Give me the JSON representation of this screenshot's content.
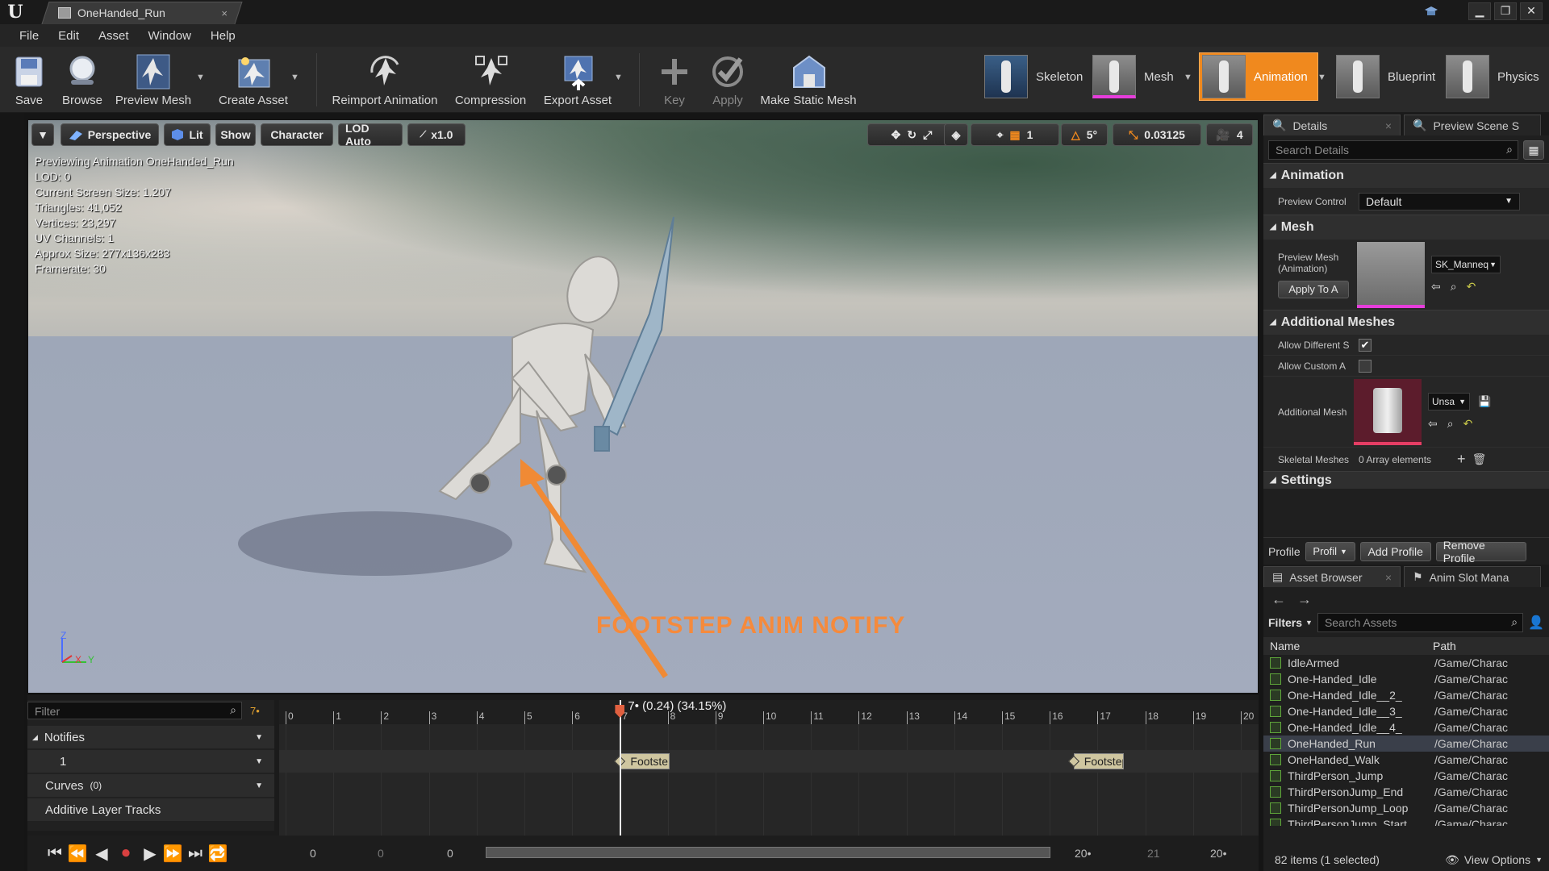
{
  "window": {
    "doc_tab": "OneHanded_Run",
    "tab_close": "×",
    "controls": [
      "▁",
      "❐",
      "✕"
    ]
  },
  "menu": [
    "File",
    "Edit",
    "Asset",
    "Window",
    "Help"
  ],
  "toolbar": {
    "buttons": [
      {
        "label": "Save",
        "icon": "save-icon"
      },
      {
        "label": "Browse",
        "icon": "browse-icon"
      },
      {
        "label": "Preview Mesh",
        "icon": "preview-mesh-icon"
      },
      {
        "label": "Create Asset",
        "icon": "create-asset-icon"
      },
      {
        "label": "Reimport Animation",
        "icon": "reimport-icon"
      },
      {
        "label": "Compression",
        "icon": "compression-icon"
      },
      {
        "label": "Export Asset",
        "icon": "export-icon"
      },
      {
        "label": "Key",
        "icon": "key-icon"
      },
      {
        "label": "Apply",
        "icon": "apply-icon"
      },
      {
        "label": "Make Static Mesh",
        "icon": "static-mesh-icon"
      }
    ],
    "modes": [
      "Skeleton",
      "Mesh",
      "Animation",
      "Blueprint",
      "Physics"
    ]
  },
  "viewport": {
    "buttons": {
      "perspective": "Perspective",
      "lit": "Lit",
      "show": "Show",
      "character": "Character",
      "lod": "LOD Auto",
      "speed": "x1.0"
    },
    "right_controls": {
      "grid_value": "1",
      "angle_value": "5°",
      "scale_value": "0.03125",
      "camera_speed": "4"
    },
    "info_lines": [
      "Previewing Animation OneHanded_Run",
      "LOD: 0",
      "Current Screen Size: 1.207",
      "Triangles: 41,052",
      "Vertices: 23,297",
      "UV Channels: 1",
      "Approx Size: 277x136x283",
      "Framerate: 30"
    ],
    "annotation": "FOOTSTEP ANIM NOTIFY",
    "axis": {
      "z": "Z",
      "x": "X",
      "y": "Y"
    }
  },
  "details": {
    "tabs": [
      "Details",
      "Preview Scene S"
    ],
    "search_placeholder": "Search Details",
    "animation_header": "Animation",
    "preview_controller_label": "Preview Control",
    "preview_controller_value": "Default",
    "mesh_header": "Mesh",
    "preview_mesh_label": "Preview Mesh (Animation)",
    "preview_mesh_value": "SK_Manneq",
    "apply_to_asset": "Apply To A",
    "additional_header": "Additional Meshes",
    "allow_different_label": "Allow Different S",
    "allow_different_checked": true,
    "allow_custom_label": "Allow Custom A",
    "allow_custom_checked": false,
    "additional_mesh_label": "Additional Mesh",
    "additional_mesh_value": "Unsa",
    "skeletal_meshes_label": "Skeletal Meshes",
    "skeletal_meshes_value": "0 Array elements",
    "settings_header": "Settings",
    "profile_label": "Profile",
    "profile_value": "Profil",
    "add_profile": "Add Profile",
    "remove_profile": "Remove Profile"
  },
  "asset_browser": {
    "tabs": [
      "Asset Browser",
      "Anim Slot Mana"
    ],
    "filters_label": "Filters",
    "search_placeholder": "Search Assets",
    "col_name": "Name",
    "col_path": "Path",
    "rows": [
      {
        "name": "IdleArmed",
        "path": "/Game/Charac"
      },
      {
        "name": "One-Handed_Idle",
        "path": "/Game/Charac"
      },
      {
        "name": "One-Handed_Idle__2_",
        "path": "/Game/Charac"
      },
      {
        "name": "One-Handed_Idle__3_",
        "path": "/Game/Charac"
      },
      {
        "name": "One-Handed_Idle__4_",
        "path": "/Game/Charac"
      },
      {
        "name": "OneHanded_Run",
        "path": "/Game/Charac",
        "selected": true
      },
      {
        "name": "OneHanded_Walk",
        "path": "/Game/Charac"
      },
      {
        "name": "ThirdPerson_Jump",
        "path": "/Game/Charac"
      },
      {
        "name": "ThirdPersonJump_End",
        "path": "/Game/Charac"
      },
      {
        "name": "ThirdPersonJump_Loop",
        "path": "/Game/Charac"
      },
      {
        "name": "ThirdPersonJump_Start",
        "path": "/Game/Charac"
      }
    ],
    "status": "82 items (1 selected)",
    "view_options": "View Options"
  },
  "timeline": {
    "filter_placeholder": "Filter",
    "current_frame_marker": "7•",
    "tracks": {
      "notifies": "Notifies",
      "notify_track": "1",
      "curves": "Curves",
      "curves_count": "(0)",
      "additive": "Additive Layer Tracks"
    },
    "scrub_label": "7• (0.24) (34.15%)",
    "ruler_ticks": [
      "0",
      "1",
      "2",
      "3",
      "4",
      "5",
      "6",
      "7",
      "8",
      "9",
      "10",
      "11",
      "12",
      "13",
      "14",
      "15",
      "16",
      "17",
      "18",
      "19",
      "20"
    ],
    "notifies": [
      {
        "label": "Footstep",
        "frame": 7
      },
      {
        "label": "Footstep",
        "frame": 16.5
      }
    ],
    "bottom_numbers": [
      "0",
      "0",
      "0",
      "20•",
      "21",
      "20•"
    ],
    "playhead_frame": 7,
    "total_frames": 20
  },
  "colors": {
    "accent_orange": "#f0891e",
    "annotation_orange": "#f58a3c",
    "playhead": "#e06040"
  }
}
